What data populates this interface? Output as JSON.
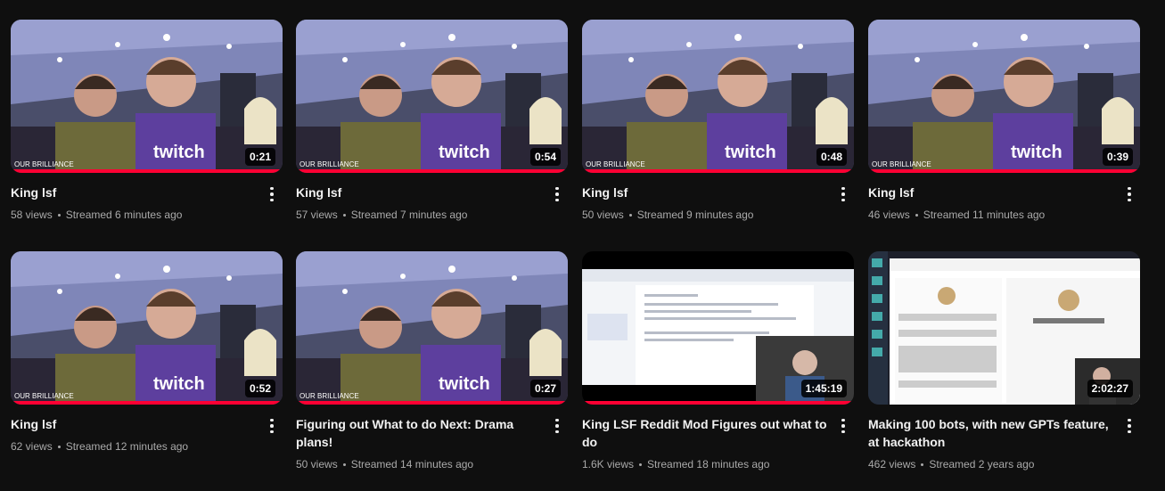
{
  "videos": [
    {
      "title": "King lsf",
      "views": "58 views",
      "age": "Streamed 6 minutes ago",
      "duration": "0:21",
      "thumbnail": "event-photo",
      "watched_fraction": 1.0
    },
    {
      "title": "King lsf",
      "views": "57 views",
      "age": "Streamed 7 minutes ago",
      "duration": "0:54",
      "thumbnail": "event-photo",
      "watched_fraction": 1.0
    },
    {
      "title": "King lsf",
      "views": "50 views",
      "age": "Streamed 9 minutes ago",
      "duration": "0:48",
      "thumbnail": "event-photo",
      "watched_fraction": 1.0
    },
    {
      "title": "King lsf",
      "views": "46 views",
      "age": "Streamed 11 minutes ago",
      "duration": "0:39",
      "thumbnail": "event-photo",
      "watched_fraction": 1.0
    },
    {
      "title": "King lsf",
      "views": "62 views",
      "age": "Streamed 12 minutes ago",
      "duration": "0:52",
      "thumbnail": "event-photo",
      "watched_fraction": 1.0
    },
    {
      "title": "Figuring out What to do Next: Drama plans!",
      "views": "50 views",
      "age": "Streamed 14 minutes ago",
      "duration": "0:27",
      "thumbnail": "event-photo",
      "watched_fraction": 1.0
    },
    {
      "title": "King LSF Reddit Mod Figures out what to do",
      "views": "1.6K views",
      "age": "Streamed 18 minutes ago",
      "duration": "1:45:19",
      "thumbnail": "doc-screen-with-webcam",
      "watched_fraction": 1.0
    },
    {
      "title": "Making 100 bots, with new GPTs feature, at hackathon",
      "views": "462 views",
      "age": "Streamed 2 years ago",
      "duration": "2:02:27",
      "thumbnail": "gpt-builder-screen-with-webcam",
      "watched_fraction": 0.0
    }
  ],
  "icons": {
    "more": "more-vert-icon"
  },
  "colors": {
    "background": "#0f0f0f",
    "progress": "#ff0033",
    "title": "#f1f1f1",
    "meta": "#aaaaaa"
  }
}
